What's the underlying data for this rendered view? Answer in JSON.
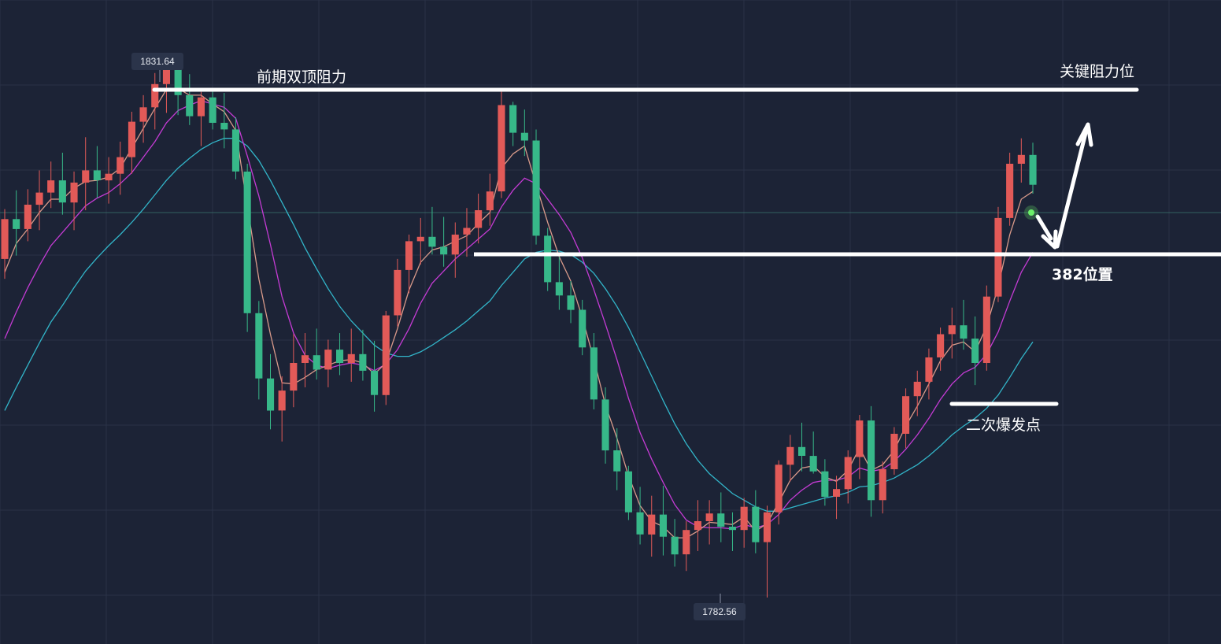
{
  "chart_data": {
    "type": "candlestick",
    "title": "",
    "xlabel": "",
    "ylabel": "",
    "ylim": [
      1778.4,
      1836.6
    ],
    "grid": true,
    "high_marker": "1831.64",
    "low_marker": "1782.56",
    "candles": [
      [
        1813.2,
        1817.7,
        1811.4,
        1816.8
      ],
      [
        1816.8,
        1819.4,
        1813.5,
        1815.9
      ],
      [
        1815.9,
        1819.5,
        1814.8,
        1818.1
      ],
      [
        1818.1,
        1821.2,
        1815.8,
        1819.2
      ],
      [
        1819.2,
        1822.0,
        1817.8,
        1820.3
      ],
      [
        1820.3,
        1822.8,
        1817.2,
        1818.3
      ],
      [
        1818.3,
        1821.1,
        1815.8,
        1820.1
      ],
      [
        1820.1,
        1824.2,
        1817.6,
        1821.2
      ],
      [
        1821.2,
        1823.4,
        1818.7,
        1820.3
      ],
      [
        1820.3,
        1822.4,
        1818.2,
        1820.9
      ],
      [
        1820.9,
        1823.8,
        1819.0,
        1822.4
      ],
      [
        1822.4,
        1826.5,
        1820.9,
        1825.6
      ],
      [
        1825.6,
        1828.0,
        1823.7,
        1826.9
      ],
      [
        1826.9,
        1830.0,
        1824.9,
        1829.0
      ],
      [
        1829.0,
        1831.6,
        1826.4,
        1830.5
      ],
      [
        1830.5,
        1831.0,
        1826.2,
        1828.0
      ],
      [
        1828.0,
        1829.9,
        1825.3,
        1826.1
      ],
      [
        1826.1,
        1828.3,
        1823.4,
        1827.8
      ],
      [
        1827.8,
        1828.5,
        1824.9,
        1825.5
      ],
      [
        1825.5,
        1828.2,
        1823.2,
        1824.9
      ],
      [
        1824.9,
        1826.0,
        1820.4,
        1821.1
      ],
      [
        1821.1,
        1821.8,
        1806.6,
        1808.3
      ],
      [
        1808.3,
        1809.4,
        1800.5,
        1802.4
      ],
      [
        1802.4,
        1804.6,
        1797.8,
        1799.5
      ],
      [
        1799.5,
        1802.6,
        1796.7,
        1801.3
      ],
      [
        1801.3,
        1806.4,
        1799.8,
        1803.8
      ],
      [
        1803.8,
        1806.5,
        1801.6,
        1804.5
      ],
      [
        1804.5,
        1806.9,
        1802.3,
        1803.2
      ],
      [
        1803.2,
        1805.9,
        1801.6,
        1805.0
      ],
      [
        1805.0,
        1806.5,
        1802.7,
        1803.8
      ],
      [
        1803.8,
        1806.9,
        1802.1,
        1804.6
      ],
      [
        1804.6,
        1806.8,
        1802.2,
        1803.1
      ],
      [
        1803.1,
        1805.8,
        1799.4,
        1800.9
      ],
      [
        1800.9,
        1808.5,
        1800.0,
        1808.1
      ],
      [
        1808.1,
        1813.2,
        1807.1,
        1812.2
      ],
      [
        1812.2,
        1815.4,
        1810.1,
        1814.8
      ],
      [
        1814.8,
        1816.9,
        1812.7,
        1815.2
      ],
      [
        1815.2,
        1817.9,
        1813.6,
        1814.3
      ],
      [
        1814.3,
        1817.0,
        1812.5,
        1813.6
      ],
      [
        1813.6,
        1816.5,
        1811.5,
        1815.4
      ],
      [
        1815.4,
        1817.8,
        1813.4,
        1816.0
      ],
      [
        1816.0,
        1819.1,
        1814.6,
        1817.6
      ],
      [
        1817.6,
        1820.9,
        1816.2,
        1819.3
      ],
      [
        1819.3,
        1828.5,
        1818.7,
        1827.1
      ],
      [
        1827.1,
        1827.4,
        1823.4,
        1824.6
      ],
      [
        1824.6,
        1826.7,
        1822.5,
        1823.9
      ],
      [
        1823.9,
        1824.9,
        1814.5,
        1815.3
      ],
      [
        1815.3,
        1816.0,
        1810.3,
        1811.1
      ],
      [
        1811.1,
        1813.4,
        1808.6,
        1809.9
      ],
      [
        1809.9,
        1811.2,
        1807.4,
        1808.6
      ],
      [
        1808.6,
        1809.5,
        1804.5,
        1805.2
      ],
      [
        1805.2,
        1806.5,
        1799.6,
        1800.5
      ],
      [
        1800.5,
        1801.6,
        1794.7,
        1795.9
      ],
      [
        1795.9,
        1797.9,
        1792.3,
        1794.0
      ],
      [
        1794.0,
        1794.5,
        1789.6,
        1790.3
      ],
      [
        1790.3,
        1792.6,
        1787.4,
        1788.3
      ],
      [
        1788.3,
        1791.8,
        1786.3,
        1790.1
      ],
      [
        1790.1,
        1792.7,
        1786.4,
        1788.1
      ],
      [
        1788.1,
        1789.7,
        1785.4,
        1786.5
      ],
      [
        1786.5,
        1789.5,
        1785.0,
        1788.7
      ],
      [
        1788.7,
        1791.4,
        1786.8,
        1789.5
      ],
      [
        1789.5,
        1791.4,
        1787.4,
        1790.2
      ],
      [
        1790.2,
        1792.1,
        1787.6,
        1789.0
      ],
      [
        1789.0,
        1790.3,
        1786.8,
        1788.7
      ],
      [
        1788.7,
        1791.6,
        1787.1,
        1790.8
      ],
      [
        1790.8,
        1792.3,
        1786.6,
        1787.6
      ],
      [
        1787.6,
        1790.9,
        1782.6,
        1790.3
      ],
      [
        1790.3,
        1795.0,
        1789.2,
        1794.6
      ],
      [
        1794.6,
        1797.3,
        1793.1,
        1796.2
      ],
      [
        1796.2,
        1798.4,
        1794.0,
        1795.4
      ],
      [
        1795.4,
        1797.6,
        1793.8,
        1794.0
      ],
      [
        1794.0,
        1795.1,
        1790.9,
        1791.7
      ],
      [
        1791.7,
        1793.6,
        1789.7,
        1792.4
      ],
      [
        1792.4,
        1795.9,
        1791.1,
        1795.3
      ],
      [
        1795.3,
        1799.1,
        1793.3,
        1798.6
      ],
      [
        1798.6,
        1799.9,
        1789.9,
        1791.4
      ],
      [
        1791.4,
        1794.9,
        1790.2,
        1794.2
      ],
      [
        1794.2,
        1798.0,
        1793.7,
        1797.4
      ],
      [
        1797.4,
        1801.5,
        1796.1,
        1800.8
      ],
      [
        1800.8,
        1803.1,
        1799.0,
        1802.1
      ],
      [
        1802.1,
        1805.1,
        1800.5,
        1804.3
      ],
      [
        1804.3,
        1807.0,
        1803.1,
        1806.4
      ],
      [
        1806.4,
        1808.8,
        1804.2,
        1807.2
      ],
      [
        1807.2,
        1809.5,
        1805.0,
        1806.0
      ],
      [
        1806.0,
        1808.0,
        1801.8,
        1803.8
      ],
      [
        1803.8,
        1810.8,
        1803.1,
        1809.8
      ],
      [
        1809.8,
        1817.9,
        1809.3,
        1816.9
      ],
      [
        1816.9,
        1822.8,
        1816.2,
        1821.8
      ],
      [
        1821.8,
        1824.1,
        1820.1,
        1822.6
      ],
      [
        1822.6,
        1823.7,
        1819.1,
        1819.9
      ]
    ],
    "ma_fast": [
      1812.0,
      1814.6,
      1815.9,
      1817.4,
      1818.6,
      1818.6,
      1819.6,
      1820.2,
      1820.3,
      1820.6,
      1821.4,
      1823.2,
      1825.0,
      1826.8,
      1828.5,
      1828.6,
      1828.0,
      1828.0,
      1827.2,
      1826.5,
      1824.8,
      1818.0,
      1811.4,
      1806.4,
      1802.0,
      1801.9,
      1802.5,
      1803.2,
      1803.6,
      1804.0,
      1804.1,
      1803.8,
      1802.8,
      1803.8,
      1806.9,
      1810.4,
      1812.9,
      1814.0,
      1814.3,
      1814.8,
      1815.3,
      1816.4,
      1817.4,
      1821.4,
      1822.7,
      1823.4,
      1819.9,
      1816.5,
      1813.4,
      1811.2,
      1807.9,
      1804.1,
      1800.0,
      1797.0,
      1793.6,
      1790.9,
      1789.5,
      1789.0,
      1788.0,
      1788.0,
      1788.6,
      1789.4,
      1789.3,
      1789.2,
      1789.9,
      1788.6,
      1789.3,
      1791.2,
      1793.2,
      1794.3,
      1794.5,
      1793.5,
      1793.1,
      1794.1,
      1796.1,
      1794.1,
      1794.6,
      1795.9,
      1798.1,
      1799.9,
      1801.9,
      1804.0,
      1805.4,
      1805.7,
      1804.8,
      1807.1,
      1810.7,
      1815.4,
      1818.6,
      1819.3
    ],
    "ma_mid": [
      1806.0,
      1808.4,
      1810.6,
      1812.6,
      1814.4,
      1815.6,
      1816.8,
      1818.0,
      1818.7,
      1819.2,
      1820.0,
      1821.0,
      1822.4,
      1823.8,
      1825.5,
      1826.6,
      1827.1,
      1827.5,
      1827.2,
      1826.9,
      1825.9,
      1822.5,
      1818.9,
      1814.5,
      1809.8,
      1806.5,
      1804.5,
      1803.6,
      1803.3,
      1803.6,
      1803.8,
      1803.6,
      1803.1,
      1803.7,
      1805.0,
      1806.9,
      1809.2,
      1811.0,
      1812.1,
      1813.2,
      1814.1,
      1815.0,
      1815.9,
      1817.9,
      1819.4,
      1820.5,
      1820.0,
      1818.6,
      1817.2,
      1815.6,
      1813.3,
      1810.4,
      1807.3,
      1804.1,
      1800.6,
      1797.5,
      1795.1,
      1793.0,
      1791.0,
      1789.6,
      1789.0,
      1788.9,
      1788.9,
      1788.8,
      1789.2,
      1788.9,
      1789.2,
      1790.1,
      1791.4,
      1792.3,
      1793.0,
      1793.2,
      1793.2,
      1793.5,
      1794.3,
      1794.0,
      1794.2,
      1794.9,
      1796.0,
      1797.3,
      1798.8,
      1800.5,
      1801.9,
      1802.9,
      1803.4,
      1804.6,
      1806.6,
      1809.4,
      1812.0,
      1813.8
    ],
    "ma_slow": [
      1799.5,
      1801.6,
      1803.6,
      1805.6,
      1807.5,
      1809.0,
      1810.6,
      1812.1,
      1813.3,
      1814.4,
      1815.4,
      1816.5,
      1817.7,
      1819.0,
      1820.3,
      1821.4,
      1822.3,
      1823.1,
      1823.7,
      1824.1,
      1824.1,
      1823.4,
      1822.1,
      1820.3,
      1818.3,
      1816.3,
      1814.2,
      1812.3,
      1810.5,
      1808.9,
      1807.6,
      1806.5,
      1805.4,
      1804.7,
      1804.4,
      1804.4,
      1804.8,
      1805.4,
      1806.1,
      1806.8,
      1807.6,
      1808.5,
      1809.4,
      1810.8,
      1812.0,
      1813.2,
      1813.8,
      1814.0,
      1813.9,
      1813.6,
      1812.9,
      1811.9,
      1810.5,
      1808.9,
      1807.0,
      1804.8,
      1802.6,
      1800.4,
      1798.3,
      1796.5,
      1795.0,
      1793.8,
      1792.9,
      1792.0,
      1791.4,
      1790.8,
      1790.4,
      1790.4,
      1790.7,
      1791.0,
      1791.3,
      1791.6,
      1791.8,
      1792.1,
      1792.6,
      1792.7,
      1793.0,
      1793.4,
      1794.0,
      1794.6,
      1795.4,
      1796.3,
      1797.3,
      1798.1,
      1798.8,
      1799.7,
      1800.9,
      1802.5,
      1804.2,
      1805.7
    ]
  },
  "annotations": {
    "double_top_resistance": "前期双顶阻力",
    "key_resistance": "关键阻力位",
    "fib_382": "382位置",
    "second_breakout": "二次爆发点"
  },
  "colors": {
    "background": "#1c2336",
    "bull": "#e25a58",
    "bear": "#37b889",
    "ma_fast": "#d99a8a",
    "ma_mid": "#c43bd4",
    "ma_slow": "#32b5c9",
    "annotation": "#ffffff"
  }
}
